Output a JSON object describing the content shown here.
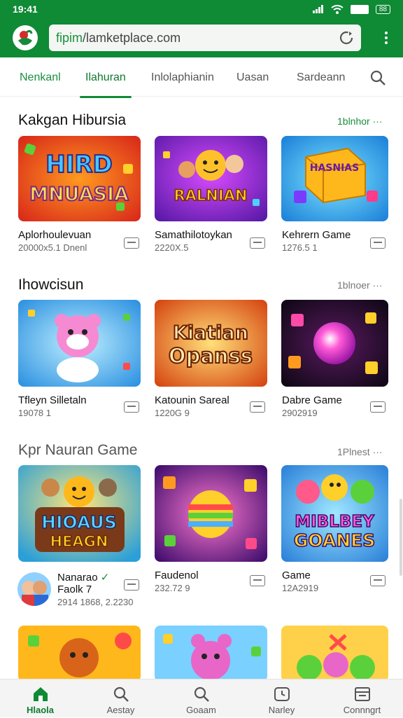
{
  "status_bar": {
    "time": "19:41",
    "battery_label": "88"
  },
  "browser": {
    "url_scheme": "fipim",
    "url_rest": "/lamketplace.com"
  },
  "tabs": [
    {
      "label": "Nenkanl"
    },
    {
      "label": "Ilahuran"
    },
    {
      "label": "Inlolaphianin"
    },
    {
      "label": "Uasan"
    },
    {
      "label": "Sardeann"
    }
  ],
  "sections": [
    {
      "title": "Kakgan Hibursia",
      "see_more": "1blnhor",
      "cards": [
        {
          "title": "Aplorhoulevuan",
          "meta": "20000x5.1 Dnenl",
          "art_text": [
            "HIRD",
            "MNUASIA"
          ]
        },
        {
          "title": "Samathilotoykan",
          "meta": "2220X.5",
          "art_text": [
            "RALNIAN"
          ]
        },
        {
          "title": "Kehrern Game",
          "meta": "1276.5 1",
          "art_text": [
            "HASNIAS"
          ]
        }
      ]
    },
    {
      "title": "Ihowcisun",
      "see_more": "1blnoer",
      "cards": [
        {
          "title": "Tfleyn Silletaln",
          "meta": "19078 1",
          "art_text": []
        },
        {
          "title": "Katounin Sareal",
          "meta": "1220G 9",
          "art_text": [
            "Kiatian",
            "Opanss"
          ]
        },
        {
          "title": "Dabre Game",
          "meta": "2902919",
          "art_text": []
        }
      ]
    },
    {
      "title": "Kpr Nauran Game",
      "see_more": "1Plnest",
      "cards": [
        {
          "title": "Nanarao",
          "subtitle": "Faolk 7",
          "meta": "2914 1868, 2.2230",
          "art_text": [
            "HIOAUS",
            "HEAGN"
          ]
        },
        {
          "title": "Faudenol",
          "meta": "232.72 9",
          "art_text": []
        },
        {
          "title": "Game",
          "meta": "12A2919",
          "art_text": [
            "MIBLBEY",
            "GOANES"
          ]
        }
      ]
    }
  ],
  "bottom_nav": [
    {
      "label": "Hlaola",
      "icon": "home-icon"
    },
    {
      "label": "Aestay",
      "icon": "search-icon"
    },
    {
      "label": "Goaam",
      "icon": "search-icon"
    },
    {
      "label": "Narley",
      "icon": "history-icon"
    },
    {
      "label": "Connngrt",
      "icon": "inbox-icon"
    }
  ],
  "colors": {
    "brand": "#0f8a35",
    "active_tab": "#0f7a30"
  }
}
